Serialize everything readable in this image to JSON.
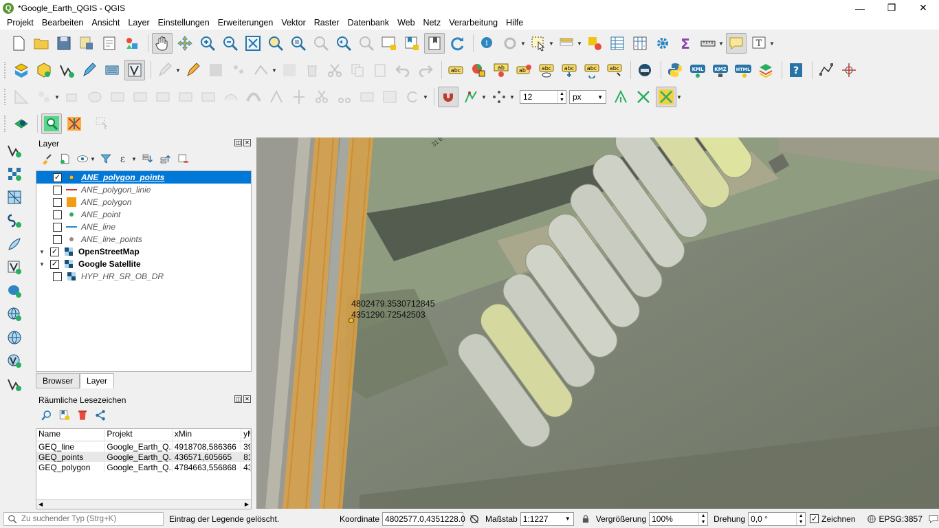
{
  "window": {
    "title": "*Google_Earth_QGIS - QGIS"
  },
  "menu": [
    "Projekt",
    "Bearbeiten",
    "Ansicht",
    "Layer",
    "Einstellungen",
    "Erweiterungen",
    "Vektor",
    "Raster",
    "Datenbank",
    "Web",
    "Netz",
    "Verarbeitung",
    "Hilfe"
  ],
  "snapping": {
    "tolerance": "12",
    "unit": "px"
  },
  "layers_panel": {
    "title": "Layer",
    "layers": [
      {
        "name": "ANE_polygon_points",
        "checked": true,
        "style": "point-yellow",
        "active": true
      },
      {
        "name": "ANE_polygon_linie",
        "checked": false,
        "style": "line-red"
      },
      {
        "name": "ANE_polygon",
        "checked": false,
        "style": "poly-orange"
      },
      {
        "name": "ANE_point",
        "checked": false,
        "style": "point-green"
      },
      {
        "name": "ANE_line",
        "checked": false,
        "style": "line-blue"
      },
      {
        "name": "ANE_line_points",
        "checked": false,
        "style": "point-grey"
      },
      {
        "name": "OpenStreetMap",
        "checked": true,
        "style": "raster",
        "bold": true,
        "expander": true
      },
      {
        "name": "Google Satellite",
        "checked": true,
        "style": "raster",
        "bold": true,
        "expander": true
      },
      {
        "name": "HYP_HR_SR_OB_DR",
        "checked": false,
        "style": "raster"
      }
    ],
    "tabs": [
      "Browser",
      "Layer"
    ]
  },
  "bookmarks_panel": {
    "title": "Räumliche Lesezeichen",
    "columns": [
      "Name",
      "Projekt",
      "xMin",
      "yM"
    ],
    "rows": [
      [
        "GEQ_line",
        "Google_Earth_Q...",
        "4918708,586366",
        "39"
      ],
      [
        "GEQ_points",
        "Google_Earth_Q...",
        "436571,605665",
        "81"
      ],
      [
        "GEQ_polygon",
        "Google_Earth_Q...",
        "4784663,556868",
        "43"
      ]
    ]
  },
  "map": {
    "label_line1": "4802479.3530712845",
    "label_line2": "4351290.72542503",
    "road_label": "31 E"
  },
  "statusbar": {
    "search_placeholder": "Zu suchender Typ (Strg+K)",
    "message": "Eintrag der Legende gelöscht.",
    "coord_label": "Koordinate",
    "coord_value": "4802577.0,4351228.0",
    "scale_label": "Maßstab",
    "scale_value": "1:1227",
    "mag_label": "Vergrößerung",
    "mag_value": "100%",
    "rot_label": "Drehung",
    "rot_value": "0,0 °",
    "render_label": "Zeichnen",
    "crs": "EPSG:3857"
  },
  "colors": {
    "accent": "#0078d7",
    "qgis_green": "#589632",
    "road": "#d9a24a"
  }
}
